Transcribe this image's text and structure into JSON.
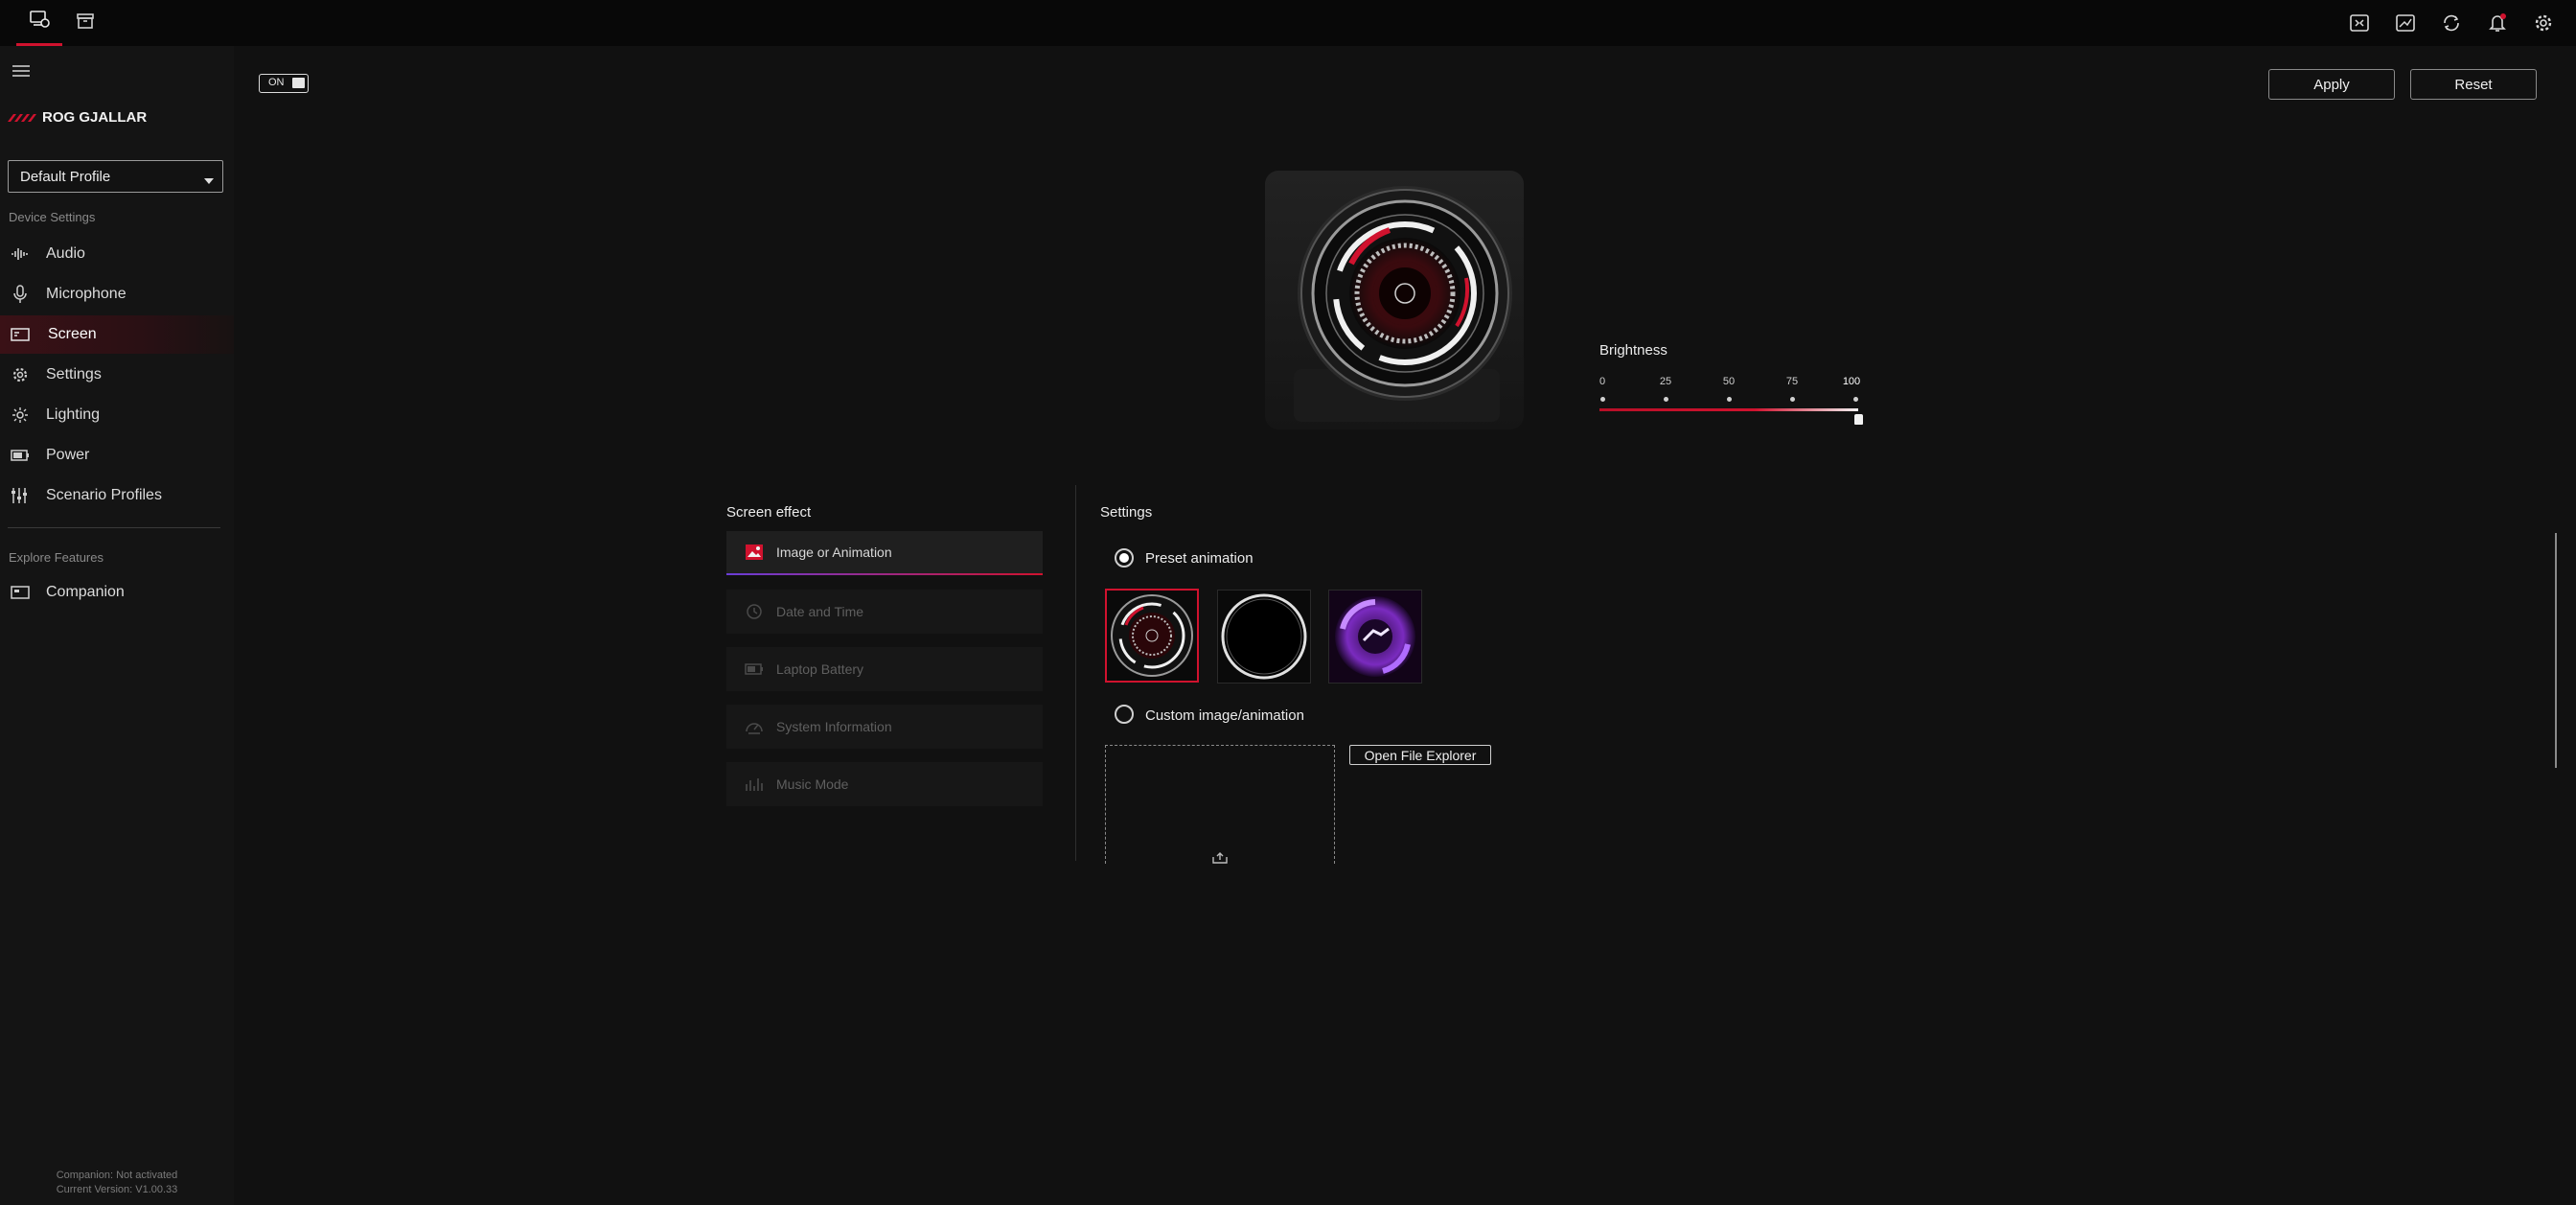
{
  "colors": {
    "accent": "#d0122e",
    "background": "#111111",
    "sidebar": "#141414",
    "topbar": "#080808"
  },
  "topbar": {
    "tabs": [
      {
        "icon": "device-icon",
        "active": true
      },
      {
        "icon": "store-icon",
        "active": false
      }
    ],
    "right_icons": [
      "keyboard-icon",
      "system-monitor-icon",
      "sync-icon",
      "notification-bell-icon",
      "gear-icon"
    ]
  },
  "sidebar": {
    "menu_icon": "hamburger-menu-icon",
    "brand": "ROG GJALLAR",
    "profile": {
      "selected": "Default Profile"
    },
    "section_device": "Device Settings",
    "items": [
      {
        "label": "Audio",
        "icon": "audio-waveform-icon",
        "active": false
      },
      {
        "label": "Microphone",
        "icon": "microphone-icon",
        "active": false
      },
      {
        "label": "Screen",
        "icon": "screen-icon",
        "active": true
      },
      {
        "label": "Settings",
        "icon": "gear-icon",
        "active": false
      },
      {
        "label": "Lighting",
        "icon": "lighting-icon",
        "active": false
      },
      {
        "label": "Power",
        "icon": "battery-icon",
        "active": false
      },
      {
        "label": "Scenario Profiles",
        "icon": "sliders-icon",
        "active": false
      }
    ],
    "section_explore": "Explore Features",
    "explore_items": [
      {
        "label": "Companion",
        "icon": "companion-icon"
      }
    ],
    "footer": {
      "line1": "Companion: Not activated",
      "line2": "Current Version: V1.00.33"
    }
  },
  "main": {
    "toggle_label": "ON",
    "apply_label": "Apply",
    "reset_label": "Reset",
    "brightness": {
      "label": "Brightness",
      "ticks": [
        "0",
        "25",
        "50",
        "75",
        "100"
      ],
      "value": 100
    },
    "screen_effect": {
      "title": "Screen effect",
      "items": [
        {
          "label": "Image or Animation",
          "icon": "image-icon",
          "active": true
        },
        {
          "label": "Date and Time",
          "icon": "clock-icon",
          "active": false
        },
        {
          "label": "Laptop Battery",
          "icon": "battery-icon",
          "active": false
        },
        {
          "label": "System Information",
          "icon": "gauge-icon",
          "active": false
        },
        {
          "label": "Music Mode",
          "icon": "equalizer-icon",
          "active": false
        }
      ]
    },
    "settings": {
      "title": "Settings",
      "preset_label": "Preset animation",
      "custom_label": "Custom image/animation",
      "open_file_label": "Open File Explorer",
      "selected_preset": 0
    }
  }
}
